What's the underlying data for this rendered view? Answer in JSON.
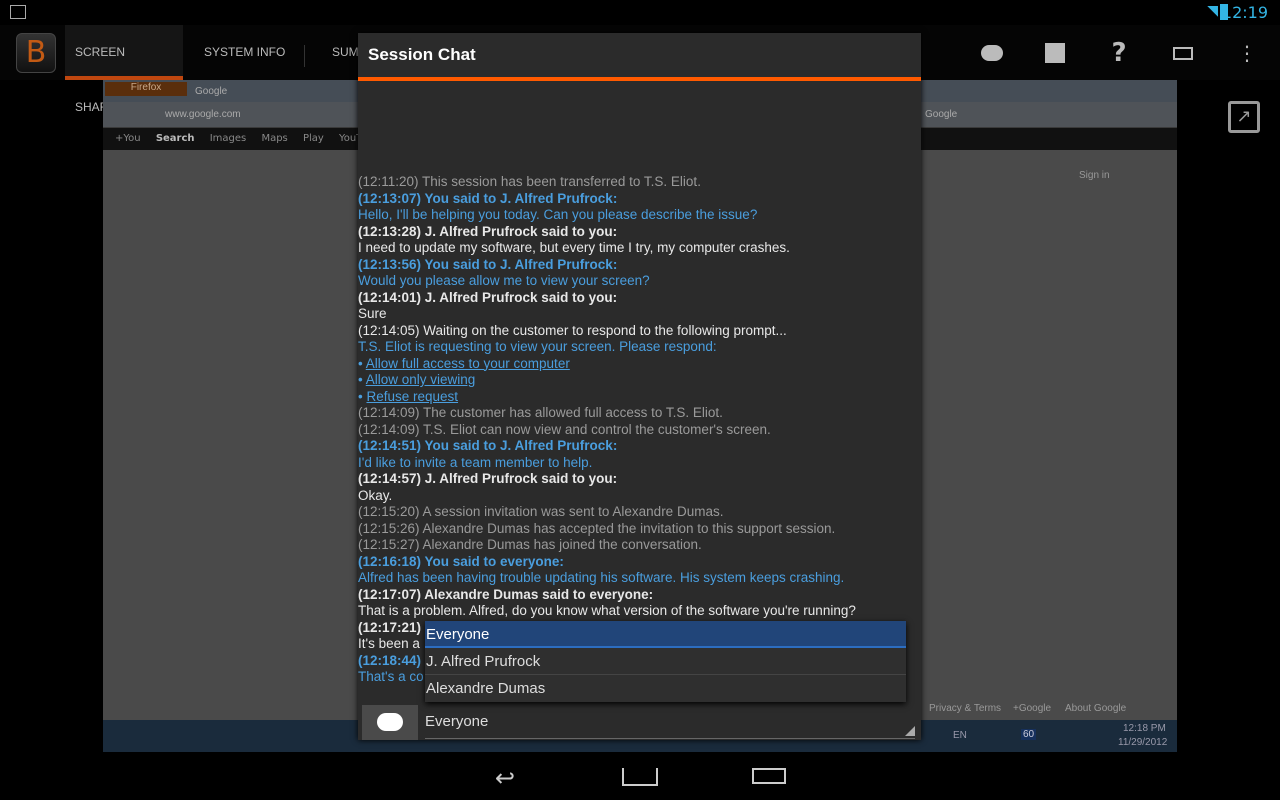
{
  "status": {
    "time": "12:19"
  },
  "actionbar": {
    "logo": "B",
    "tabs": [
      {
        "label": "SCREEN SHARING",
        "selected": true
      },
      {
        "label": "SYSTEM INFO"
      },
      {
        "label": "SUM"
      }
    ],
    "icons": [
      "chat-icon",
      "stop-icon",
      "help-icon",
      "keyboard-icon",
      "overflow-icon"
    ]
  },
  "remote": {
    "firefox": "Firefox",
    "tab": "Google",
    "url": "www.google.com",
    "search_box": "Google",
    "gbar": [
      "+You",
      "Search",
      "Images",
      "Maps",
      "Play",
      "YouTub"
    ],
    "signin": "Sign in",
    "footer": [
      "Privacy & Terms",
      "+Google",
      "About Google"
    ],
    "tray_lang": "EN",
    "tray_time": "12:18 PM",
    "tray_date": "11/29/2012",
    "tray_badge": "60"
  },
  "dialog": {
    "title": "Session Chat",
    "messages": [
      {
        "style": "sys",
        "text": "(12:11:20) This session has been transferred to T.S. Eliot."
      },
      {
        "style": "meh",
        "text": "(12:13:07) You said to J. Alfred Prufrock:"
      },
      {
        "style": "me",
        "text": "Hello, I'll be helping you today. Can you please describe the issue?"
      },
      {
        "style": "themh",
        "text": "(12:13:28) J. Alfred Prufrock said to you:"
      },
      {
        "style": "them",
        "text": "I need to update my software, but every time I try, my computer crashes."
      },
      {
        "style": "meh",
        "text": "(12:13:56) You said to J. Alfred Prufrock:"
      },
      {
        "style": "me",
        "text": "Would you please allow me to view your screen?"
      },
      {
        "style": "themh",
        "text": "(12:14:01) J. Alfred Prufrock said to you:"
      },
      {
        "style": "them",
        "text": "Sure"
      },
      {
        "style": "them",
        "text": "(12:14:05) Waiting on the customer to respond to the following prompt..."
      },
      {
        "style": "me",
        "text": "T.S. Eliot is requesting to view your screen. Please respond:"
      },
      {
        "style": "link",
        "text": "Allow full access to your computer"
      },
      {
        "style": "link",
        "text": "Allow only viewing"
      },
      {
        "style": "link",
        "text": "Refuse request"
      },
      {
        "style": "sys",
        "text": "(12:14:09) The customer has allowed full access to T.S. Eliot."
      },
      {
        "style": "sys",
        "text": "(12:14:09) T.S. Eliot can now view and control the customer's screen."
      },
      {
        "style": "meh",
        "text": "(12:14:51) You said to J. Alfred Prufrock:"
      },
      {
        "style": "me",
        "text": "I'd like to invite a team member to help."
      },
      {
        "style": "themh",
        "text": "(12:14:57) J. Alfred Prufrock said to you:"
      },
      {
        "style": "them",
        "text": "Okay."
      },
      {
        "style": "sys",
        "text": "(12:15:20) A session invitation was sent to Alexandre Dumas."
      },
      {
        "style": "sys",
        "text": "(12:15:26) Alexandre Dumas has accepted the invitation to this support session."
      },
      {
        "style": "sys",
        "text": "(12:15:27) Alexandre Dumas has joined the conversation."
      },
      {
        "style": "meh",
        "text": "(12:16:18) You said to everyone:"
      },
      {
        "style": "me",
        "text": "Alfred has been having trouble updating his software. His system keeps crashing."
      },
      {
        "style": "themh",
        "text": "(12:17:07) Alexandre Dumas said to everyone:"
      },
      {
        "style": "them",
        "text": "That is a problem. Alfred, do you know what version of the software you're running?"
      },
      {
        "style": "themh",
        "text": "(12:17:21)"
      },
      {
        "style": "them",
        "text": "It's been a"
      },
      {
        "style": "meh",
        "text": "(12:18:44)"
      },
      {
        "style": "me",
        "text": "That's a co"
      }
    ],
    "recipient_options": [
      "Everyone",
      "J. Alfred Prufrock",
      "Alexandre Dumas"
    ],
    "selected_recipient": "Everyone"
  }
}
